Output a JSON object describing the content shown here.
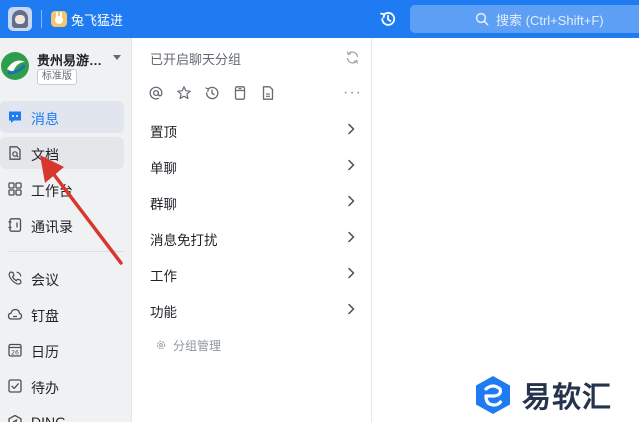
{
  "topbar": {
    "workspace_name": "兔飞猛进",
    "search_placeholder": "搜索 (Ctrl+Shift+F)"
  },
  "sidebar": {
    "org_name": "贵州易游…",
    "org_badge": "标准版",
    "items": [
      {
        "label": "消息",
        "icon": "message-icon",
        "state": "active"
      },
      {
        "label": "文档",
        "icon": "document-icon",
        "state": "hover"
      },
      {
        "label": "工作台",
        "icon": "workbench-icon",
        "state": "normal"
      },
      {
        "label": "通讯录",
        "icon": "contacts-icon",
        "state": "normal"
      },
      {
        "label": "会议",
        "icon": "phone-icon",
        "state": "normal"
      },
      {
        "label": "钉盘",
        "icon": "cloud-icon",
        "state": "normal"
      },
      {
        "label": "日历",
        "icon": "calendar-icon",
        "state": "normal"
      },
      {
        "label": "待办",
        "icon": "checkbox-icon",
        "state": "normal"
      },
      {
        "label": "DING",
        "icon": "ding-icon",
        "state": "normal"
      }
    ]
  },
  "panel": {
    "title": "已开启聊天分组",
    "filter_icons": [
      "at-icon",
      "star-icon",
      "clock-icon",
      "archive-icon",
      "file-icon"
    ],
    "more_label": "···",
    "groups": [
      {
        "label": "置顶"
      },
      {
        "label": "单聊"
      },
      {
        "label": "群聊"
      },
      {
        "label": "消息免打扰"
      },
      {
        "label": "工作"
      },
      {
        "label": "功能"
      }
    ],
    "manage_label": "分组管理"
  },
  "watermark": {
    "text": "易软汇"
  },
  "colors": {
    "brand_blue": "#1f7bf2",
    "annotation_red": "#d9372e"
  }
}
